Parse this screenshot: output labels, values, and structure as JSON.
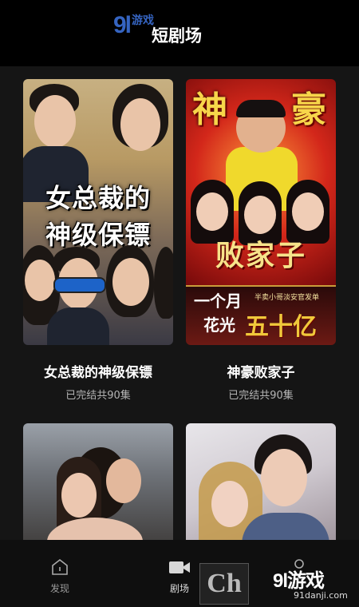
{
  "header": {
    "logo": "9l",
    "logo_suffix": "游戏",
    "title": "短剧场"
  },
  "cards": [
    {
      "title": "女总裁的神级保镖",
      "subtitle": "已完结共90集",
      "poster_text": [
        "女总裁的",
        "神级保镖"
      ]
    },
    {
      "title": "神豪败家子",
      "subtitle": "已完结共90集",
      "poster_text": {
        "top_left": "神",
        "top_right": "豪",
        "middle": "败家子",
        "line1": "一个月",
        "line1_small": "半卖小哥淡安官发单",
        "line2": "花光",
        "line2_big": "五十亿"
      }
    },
    {
      "title": "",
      "subtitle": ""
    },
    {
      "title": "",
      "subtitle": ""
    }
  ],
  "nav": {
    "items": [
      {
        "label": "发现",
        "icon": "home-icon"
      },
      {
        "label": "剧场",
        "icon": "video-icon"
      },
      {
        "label": "",
        "icon": "profile-icon"
      }
    ]
  },
  "watermark": {
    "box_text": "Ch",
    "brand": "9l游戏",
    "url": "91danji.com"
  },
  "colors": {
    "background": "#151515",
    "header": "#000000",
    "subtitle": "#b5b5b5"
  }
}
